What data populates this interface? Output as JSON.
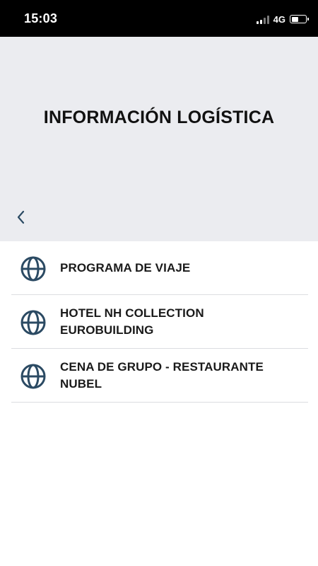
{
  "status_bar": {
    "time": "15:03",
    "network": "4G",
    "signal_icon": "signal-bars-icon",
    "battery_icon": "battery-icon",
    "battery_level": 0.35
  },
  "header": {
    "title": "INFORMACIÓN LOGÍSTICA",
    "back_icon": "chevron-left-icon"
  },
  "menu": {
    "icon": "globe-icon",
    "items": [
      {
        "label": "PROGRAMA DE VIAJE"
      },
      {
        "label": "HOTEL NH COLLECTION EUROBUILDING"
      },
      {
        "label": "CENA DE GRUPO - RESTAURANTE NUBEL"
      }
    ]
  },
  "colors": {
    "header_bg": "#ebecf0",
    "accent": "#2b4a63",
    "text": "#1a1a1a",
    "divider": "#dcdde1"
  }
}
